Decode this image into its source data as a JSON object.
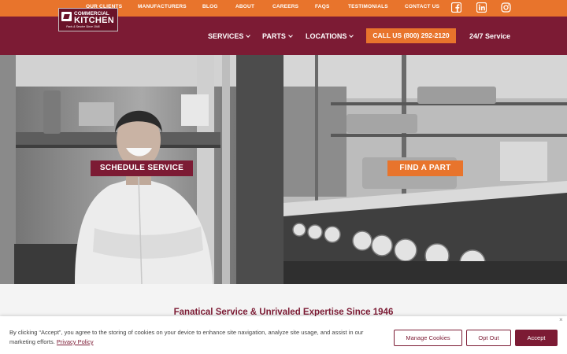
{
  "topbar": {
    "links": [
      "OUR CLIENTS",
      "MANUFACTURERS",
      "BLOG",
      "ABOUT",
      "CAREERS",
      "FAQS",
      "TESTIMONIALS",
      "CONTACT US"
    ],
    "social": [
      "facebook-icon",
      "linkedin-icon",
      "instagram-icon"
    ]
  },
  "logo": {
    "line1": "COMMERCIAL",
    "line2": "KITCHEN",
    "line3": "Parts & Service Since 1946"
  },
  "nav": {
    "services": "SERVICES",
    "parts": "PARTS",
    "locations": "LOCATIONS",
    "call": "CALL US (800) 292-2120",
    "service247": "24/7 Service"
  },
  "hero": {
    "schedule": "SCHEDULE SERVICE",
    "find_part": "FIND A PART"
  },
  "tagline": "Fanatical Service & Unrivaled Expertise Since 1946",
  "cookie": {
    "text": "By clicking “Accept”, you agree to the storing of cookies on your device to enhance site navigation, analyze site usage, and assist in our marketing efforts.",
    "policy": "Privacy Policy",
    "manage": "Manage Cookies",
    "opt_out": "Opt Out",
    "accept": "Accept",
    "close": "×"
  },
  "colors": {
    "brand_orange": "#e8742c",
    "brand_maroon": "#7c1b34"
  }
}
